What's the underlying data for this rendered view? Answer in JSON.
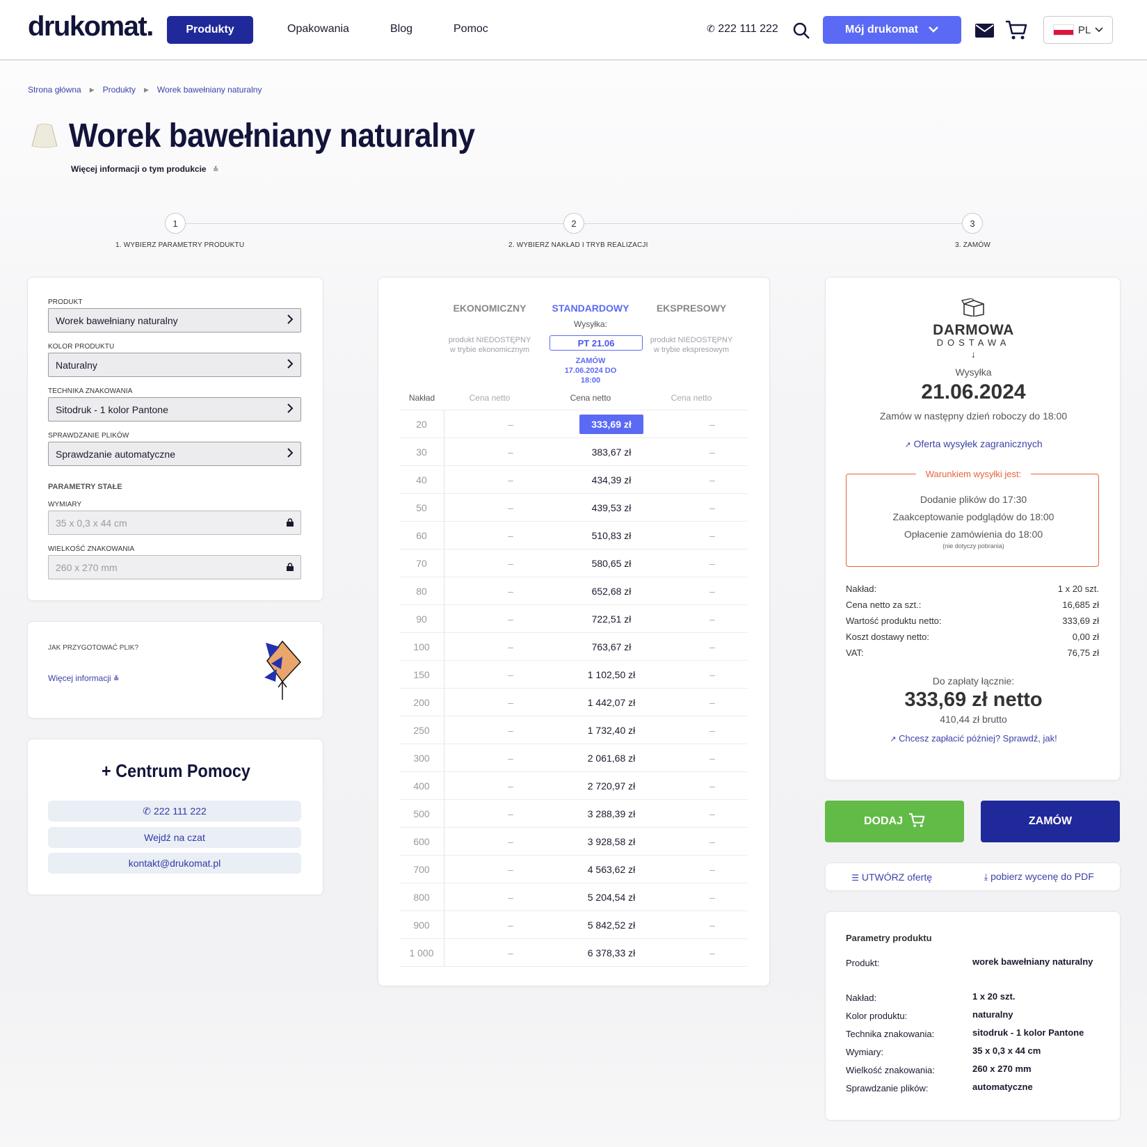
{
  "header": {
    "logo": "drukomat.",
    "nav_active": "Produkty",
    "nav_links": [
      "Opakowania",
      "Blog",
      "Pomoc"
    ],
    "phone": "222 111 222",
    "account_button": "Mój drukomat",
    "language": "PL",
    "icons": [
      "phone-icon",
      "search-icon",
      "chevron-down-icon",
      "mail-icon",
      "cart-icon",
      "flag-pl-icon"
    ]
  },
  "breadcrumb": [
    "Strona główna",
    "Produkty",
    "Worek bawełniany naturalny"
  ],
  "page": {
    "title": "Worek bawełniany naturalny",
    "more_info": "Więcej informacji o tym produkcie"
  },
  "steps": [
    {
      "num": "1",
      "label": "1. WYBIERZ PARAMETRY PRODUKTU"
    },
    {
      "num": "2",
      "label": "2. WYBIERZ NAKŁAD I TRYB REALIZACJI"
    },
    {
      "num": "3",
      "label": "3. ZAMÓW"
    }
  ],
  "params": {
    "fields": [
      {
        "label": "PRODUKT",
        "value": "Worek bawełniany naturalny"
      },
      {
        "label": "KOLOR PRODUKTU",
        "value": "Naturalny"
      },
      {
        "label": "TECHNIKA ZNAKOWANIA",
        "value": "Sitodruk - 1 kolor Pantone"
      },
      {
        "label": "SPRAWDZANIE PLIKÓW",
        "value": "Sprawdzanie automatyczne"
      }
    ],
    "fixed_heading": "PARAMETRY STAŁE",
    "fixed": [
      {
        "label": "WYMIARY",
        "value": "35 x 0,3 x 44 cm"
      },
      {
        "label": "WIELKOŚĆ ZNAKOWANIA",
        "value": "260 x 270 mm"
      }
    ]
  },
  "file_prep": {
    "question": "JAK PRZYGOTOWAĆ PLIK?",
    "link": "Więcej informacji"
  },
  "help_center": {
    "title": "+ Centrum Pomocy",
    "phone": "222 111 222",
    "chat": "Wejdź na czat",
    "email": "kontakt@drukomat.pl"
  },
  "pricing": {
    "modes": {
      "eko": "EKONOMICZNY",
      "std": "STANDARDOWY",
      "exp": "EKSPRESOWY"
    },
    "eko_na": [
      "produkt NIEDOSTĘPNY",
      "w trybie ekonomicznym"
    ],
    "exp_na": [
      "produkt NIEDOSTĘPNY",
      "w trybie ekspresowym"
    ],
    "shipping_label": "Wysyłka:",
    "shipping_date": "PT 21.06",
    "order_by": [
      "ZAMÓW",
      "17.06.2024 DO",
      "18:00"
    ],
    "col_qty": "Nakład",
    "col_price": "Cena netto",
    "dash": "–",
    "rows": [
      {
        "qty": "20",
        "price": "333,69 zł"
      },
      {
        "qty": "30",
        "price": "383,67 zł"
      },
      {
        "qty": "40",
        "price": "434,39 zł"
      },
      {
        "qty": "50",
        "price": "439,53 zł"
      },
      {
        "qty": "60",
        "price": "510,83 zł"
      },
      {
        "qty": "70",
        "price": "580,65 zł"
      },
      {
        "qty": "80",
        "price": "652,68 zł"
      },
      {
        "qty": "90",
        "price": "722,51 zł"
      },
      {
        "qty": "100",
        "price": "763,67 zł"
      },
      {
        "qty": "150",
        "price": "1 102,50 zł"
      },
      {
        "qty": "200",
        "price": "1 442,07 zł"
      },
      {
        "qty": "250",
        "price": "1 732,40 zł"
      },
      {
        "qty": "300",
        "price": "2 061,68 zł"
      },
      {
        "qty": "400",
        "price": "2 720,97 zł"
      },
      {
        "qty": "500",
        "price": "3 288,39 zł"
      },
      {
        "qty": "600",
        "price": "3 928,58 zł"
      },
      {
        "qty": "700",
        "price": "4 563,62 zł"
      },
      {
        "qty": "800",
        "price": "5 204,54 zł"
      },
      {
        "qty": "900",
        "price": "5 842,52 zł"
      },
      {
        "qty": "1 000",
        "price": "6 378,33 zł"
      }
    ]
  },
  "summary": {
    "free_top": "DARMOWA",
    "free_bottom": "DOSTAWA",
    "shipping_label": "Wysyłka",
    "shipping_date": "21.06.2024",
    "order_note": "Zamów w następny dzień roboczy do 18:00",
    "intl_link": "Oferta wysyłek zagranicznych",
    "conditions_title": "Warunkiem wysyłki jest:",
    "conditions": [
      "Dodanie plików do 17:30",
      "Zaakceptowanie podglądów do 18:00",
      "Opłacenie zamówienia do 18:00"
    ],
    "conditions_note": "(nie dotyczy pobrania)",
    "rows": [
      {
        "label": "Nakład:",
        "value": "1 x 20 szt."
      },
      {
        "label": "Cena netto za szt.:",
        "value": "16,685 zł"
      },
      {
        "label": "Wartość produktu netto:",
        "value": "333,69 zł"
      },
      {
        "label": "Koszt dostawy netto:",
        "value": "0,00 zł"
      },
      {
        "label": "VAT:",
        "value": "76,75 zł"
      }
    ],
    "total_label": "Do zapłaty łącznie:",
    "total_net": "333,69 zł netto",
    "total_gross": "410,44 zł brutto",
    "pay_later": "Chcesz zapłacić później? Sprawdź, jak!"
  },
  "actions": {
    "add": "DODAJ",
    "order": "ZAMÓW",
    "create_offer": "UTWÓRZ ofertę",
    "download_pdf": "pobierz wycenę do PDF"
  },
  "product_params": {
    "title": "Parametry produktu",
    "rows": [
      {
        "label": "Produkt:",
        "value": "worek bawełniany naturalny"
      },
      {
        "label": "Nakład:",
        "value": "1 x 20 szt."
      },
      {
        "label": "Kolor produktu:",
        "value": "naturalny"
      },
      {
        "label": "Technika znakowania:",
        "value": "sitodruk - 1 kolor Pantone"
      },
      {
        "label": "Wymiary:",
        "value": "35 x 0,3 x 44 cm"
      },
      {
        "label": "Wielkość znakowania:",
        "value": "260 x 270 mm"
      },
      {
        "label": "Sprawdzanie plików:",
        "value": "automatyczne"
      }
    ]
  },
  "colors": {
    "brand_navy": "#20299a",
    "accent": "#5b6af5",
    "green": "#62bb46",
    "warning": "#e8623a"
  }
}
